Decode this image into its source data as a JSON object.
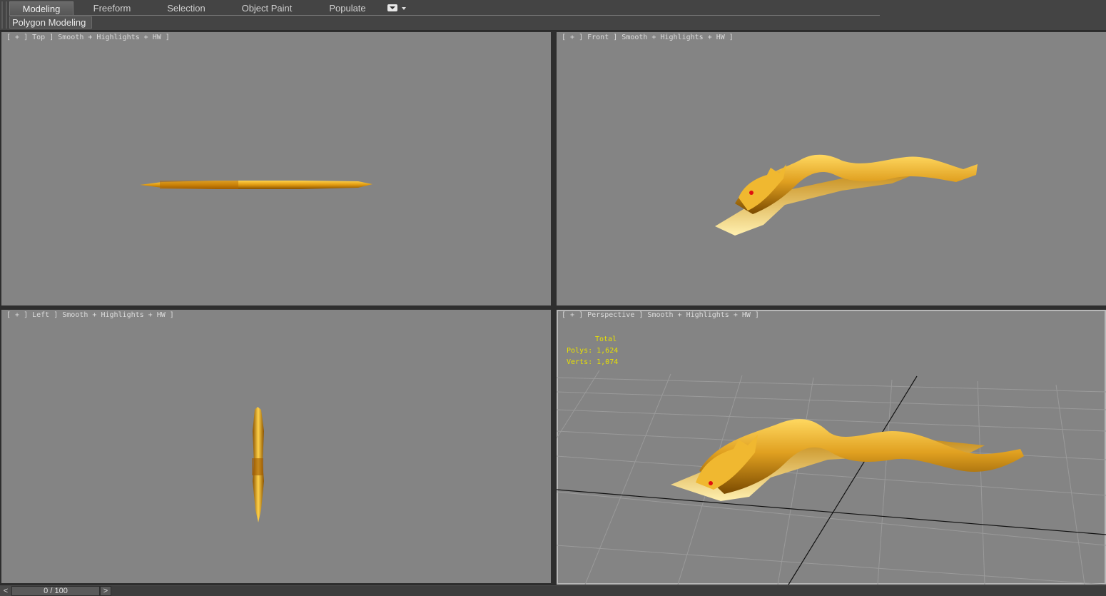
{
  "ribbon": {
    "tabs": [
      {
        "label": "Modeling",
        "active": true
      },
      {
        "label": "Freeform",
        "active": false
      },
      {
        "label": "Selection",
        "active": false
      },
      {
        "label": "Object Paint",
        "active": false
      },
      {
        "label": "Populate",
        "active": false
      }
    ],
    "sub_tab": "Polygon Modeling"
  },
  "viewports": {
    "top": {
      "label": "[ + ] Top ] Smooth + Highlights + HW ]"
    },
    "front": {
      "label": "[ + ] Front ] Smooth + Highlights + HW ]"
    },
    "left": {
      "label": "[ + ] Left ] Smooth + Highlights + HW ]"
    },
    "perspective": {
      "label": "[ + ] Perspective ] Smooth + Highlights + HW ]",
      "stats": {
        "total": "Total",
        "polys": "Polys: 1,624",
        "verts": "Verts: 1,074"
      }
    }
  },
  "timeline": {
    "prev": "<",
    "frame": "0 / 100",
    "next": ">"
  },
  "colors": {
    "viewport_bg": "#848484",
    "stats_text": "#e8e000",
    "model_gold": "#e0a020"
  }
}
